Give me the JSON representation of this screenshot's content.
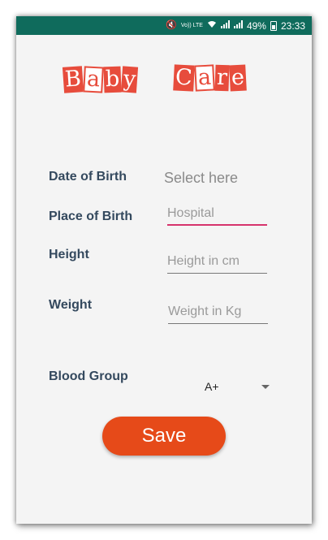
{
  "status_bar": {
    "battery_percent": "49%",
    "time": "23:33",
    "lte_label": "Vo)) LTE",
    "background_color": "#0f6b5c"
  },
  "logo": {
    "word1": [
      "B",
      "a",
      "b",
      "y"
    ],
    "word2": [
      "C",
      "a",
      "r",
      "e"
    ],
    "color": "#e74c3c"
  },
  "form": {
    "dob_label": "Date of Birth",
    "dob_value": "Select here",
    "place_label": "Place of Birth",
    "place_placeholder": "Hospital",
    "height_label": "Height",
    "height_placeholder": "Height in cm",
    "weight_label": "Weight",
    "weight_placeholder": "Weight in Kg",
    "blood_label": "Blood Group",
    "blood_value": "A+"
  },
  "save_button": {
    "label": "Save",
    "color": "#e64a19"
  }
}
